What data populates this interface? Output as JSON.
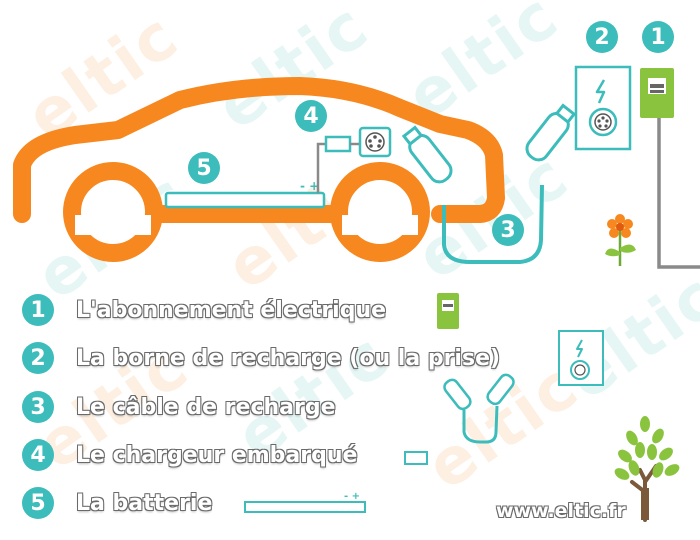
{
  "watermark": "eltic",
  "colors": {
    "orange": "#f7881f",
    "teal": "#3cbcbb",
    "green": "#8ac43f",
    "grey": "#8a8a8a"
  },
  "diagram": {
    "badges": [
      "1",
      "2",
      "3",
      "4",
      "5"
    ]
  },
  "legend": [
    {
      "num": "1",
      "label": "L'abonnement électrique",
      "icon": "meter-icon"
    },
    {
      "num": "2",
      "label": "La borne de recharge (ou la prise)",
      "icon": "charging-station-icon"
    },
    {
      "num": "3",
      "label": "Le câble de recharge",
      "icon": "cable-icon"
    },
    {
      "num": "4",
      "label": "Le chargeur embarqué",
      "icon": "onboard-charger-icon"
    },
    {
      "num": "5",
      "label": "La batterie",
      "icon": "battery-icon"
    }
  ],
  "website": "www.eltic.fr"
}
